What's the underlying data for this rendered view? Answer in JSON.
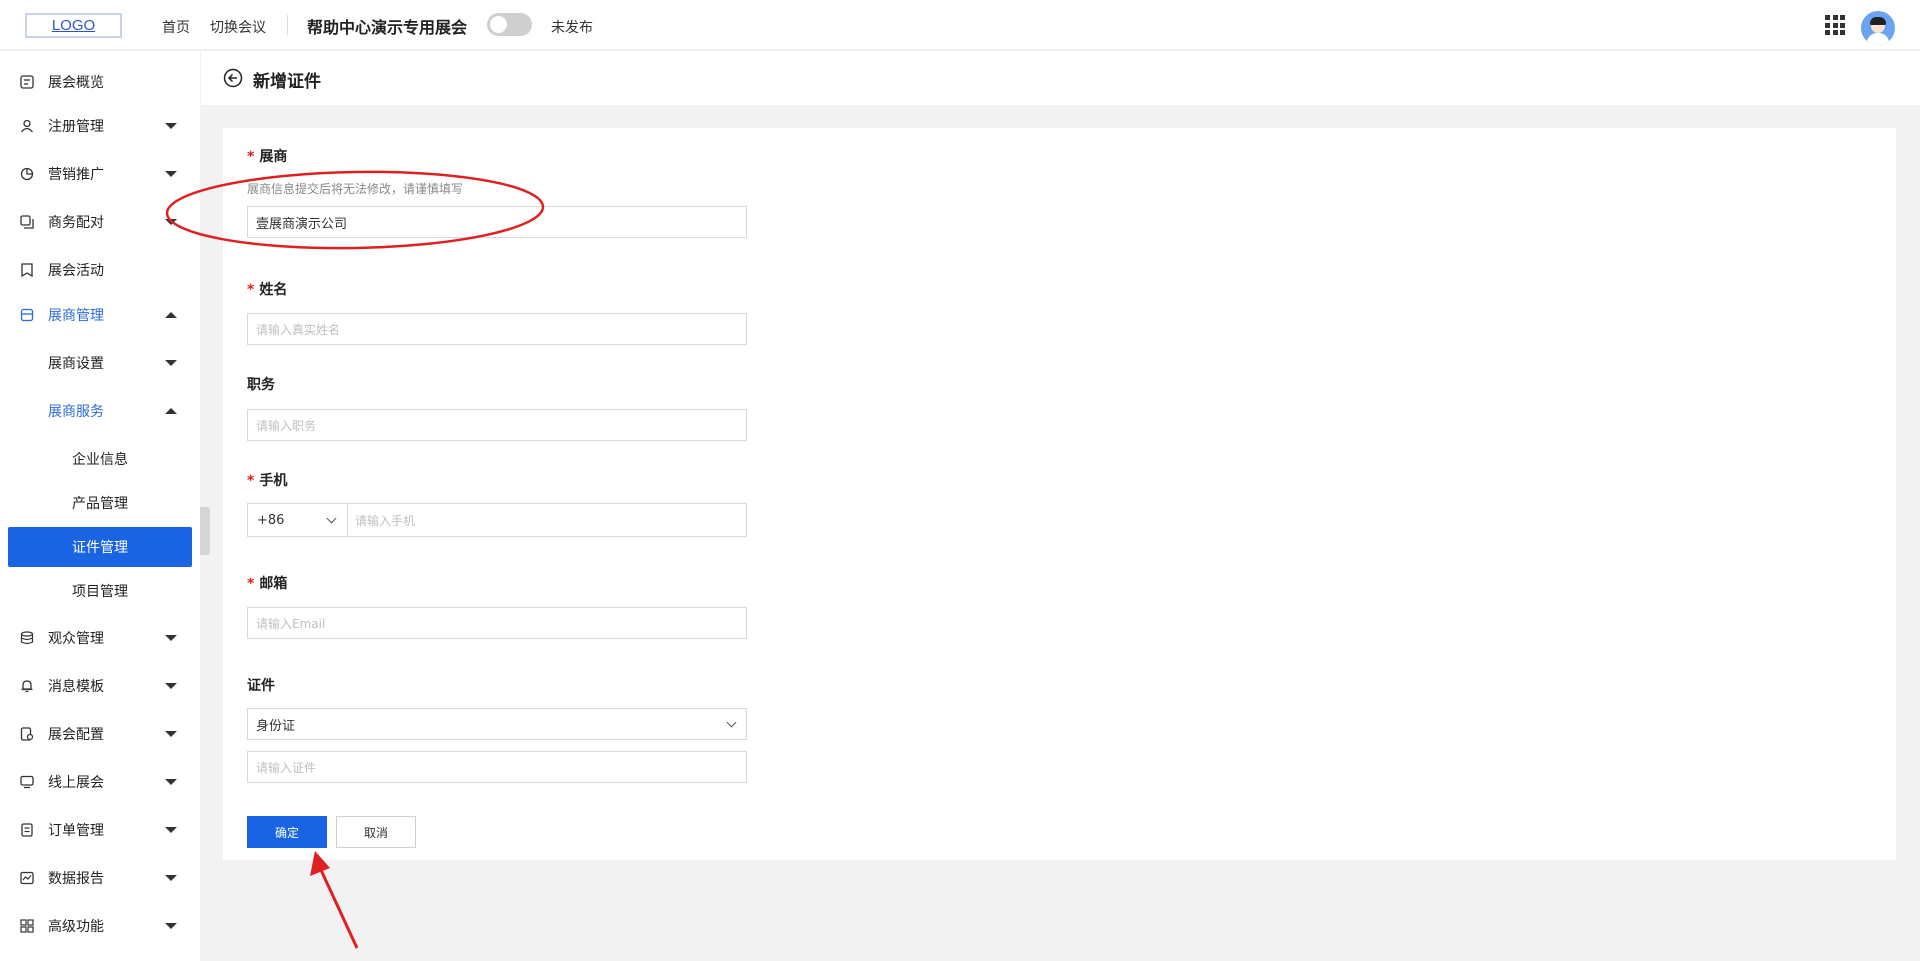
{
  "header": {
    "logo": "LOGO",
    "nav": [
      "首页",
      "切换会议"
    ],
    "expo_title": "帮助中心演示专用展会",
    "publish_status": "未发布"
  },
  "sidebar": {
    "items": [
      {
        "label": "展会概览",
        "icon": "dashboard-icon"
      },
      {
        "label": "注册管理",
        "icon": "user-icon"
      },
      {
        "label": "营销推广",
        "icon": "pie-icon"
      },
      {
        "label": "商务配对",
        "icon": "copy-icon"
      },
      {
        "label": "展会活动",
        "icon": "bookmark-icon"
      },
      {
        "label": "展商管理",
        "icon": "store-icon"
      },
      {
        "label": "展商设置"
      },
      {
        "label": "展商服务"
      },
      {
        "label": "企业信息"
      },
      {
        "label": "产品管理"
      },
      {
        "label": "证件管理"
      },
      {
        "label": "项目管理"
      },
      {
        "label": "观众管理",
        "icon": "database-icon"
      },
      {
        "label": "消息模板",
        "icon": "bell-icon"
      },
      {
        "label": "展会配置",
        "icon": "settings-doc-icon"
      },
      {
        "label": "线上展会",
        "icon": "monitor-icon"
      },
      {
        "label": "订单管理",
        "icon": "document-icon"
      },
      {
        "label": "数据报告",
        "icon": "chart-icon"
      },
      {
        "label": "高级功能",
        "icon": "grid-icon"
      }
    ]
  },
  "page": {
    "title": "新增证件"
  },
  "form": {
    "required_mark": "*",
    "exhibitor": {
      "label": "展商",
      "hint": "展商信息提交后将无法修改，请谨慎填写",
      "value": "壹展商演示公司"
    },
    "name": {
      "label": "姓名",
      "placeholder": "请输入真实姓名"
    },
    "position": {
      "label": "职务",
      "placeholder": "请输入职务"
    },
    "phone": {
      "label": "手机",
      "prefix": "+86",
      "placeholder": "请输入手机"
    },
    "email": {
      "label": "邮箱",
      "placeholder": "请输入Email"
    },
    "certificate": {
      "label": "证件",
      "type_value": "身份证",
      "placeholder": "请输入证件"
    },
    "confirm": "确定",
    "cancel": "取消"
  },
  "annotation_color": "#e02020"
}
